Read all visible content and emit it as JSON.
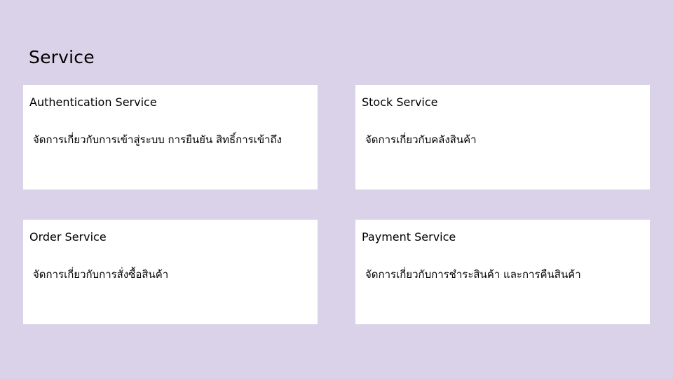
{
  "slide": {
    "title": "Service",
    "background_color": "#d9d2e9"
  },
  "cards": [
    {
      "title": "Authentication Service",
      "description": "จัดการเกี่ยวกับการเข้าสู่ระบบ การยืนยัน สิทธิ์การเข้าถึง"
    },
    {
      "title": "Stock Service",
      "description": "จัดการเกี่ยวกับคลังสินค้า"
    },
    {
      "title": "Order Service",
      "description": "จัดการเกี่ยวกับการสั่งซื้อสินค้า"
    },
    {
      "title": "Payment Service",
      "description": "จัดการเกี่ยวกับการชำระสินค้า และการคืนสินค้า"
    }
  ]
}
